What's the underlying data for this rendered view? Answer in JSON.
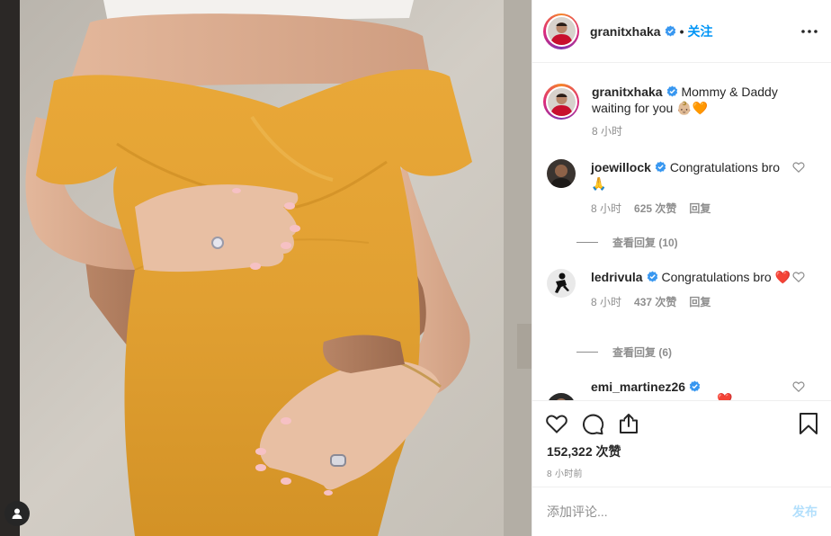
{
  "post": {
    "author": {
      "username": "granitxhaka",
      "verified": true,
      "follow_label": "关注",
      "separator": "•"
    },
    "caption": {
      "username": "granitxhaka",
      "text": "Mommy & Daddy waiting for you 👶🏼🧡",
      "time": "8 小时"
    },
    "comments": [
      {
        "username": "joewillock",
        "verified": true,
        "text": "Congratulations bro 🙏",
        "time": "8 小时",
        "likes": "625 次赞",
        "reply_label": "回复",
        "view_replies": "查看回复 (10)"
      },
      {
        "username": "ledrivula",
        "verified": true,
        "text": "Congratulations bro ❤️",
        "time": "8 小时",
        "likes": "437 次赞",
        "reply_label": "回复",
        "view_replies": "查看回复 (6)"
      },
      {
        "username": "emi_martinez26",
        "verified": true,
        "text": "❤️"
      }
    ],
    "likes_count": "152,322 次赞",
    "posted_ago": "8 小时前",
    "comment_input": {
      "placeholder": "添加评论...",
      "value": ""
    },
    "post_button_label": "发布"
  },
  "icons": {
    "more": "more-horizontal-icon",
    "like": "heart-icon",
    "comment": "comment-icon",
    "share": "share-icon",
    "save": "bookmark-icon",
    "tags": "user-tag-icon",
    "verified": "verified-badge-icon"
  },
  "colors": {
    "link_blue": "#0095f6",
    "verified_blue": "#3897f0",
    "muted_text": "#8e8e8e",
    "post_button_disabled": "#b2dffc",
    "heart_red": "#ed4956",
    "dress_mustard": "#e3a12f"
  }
}
